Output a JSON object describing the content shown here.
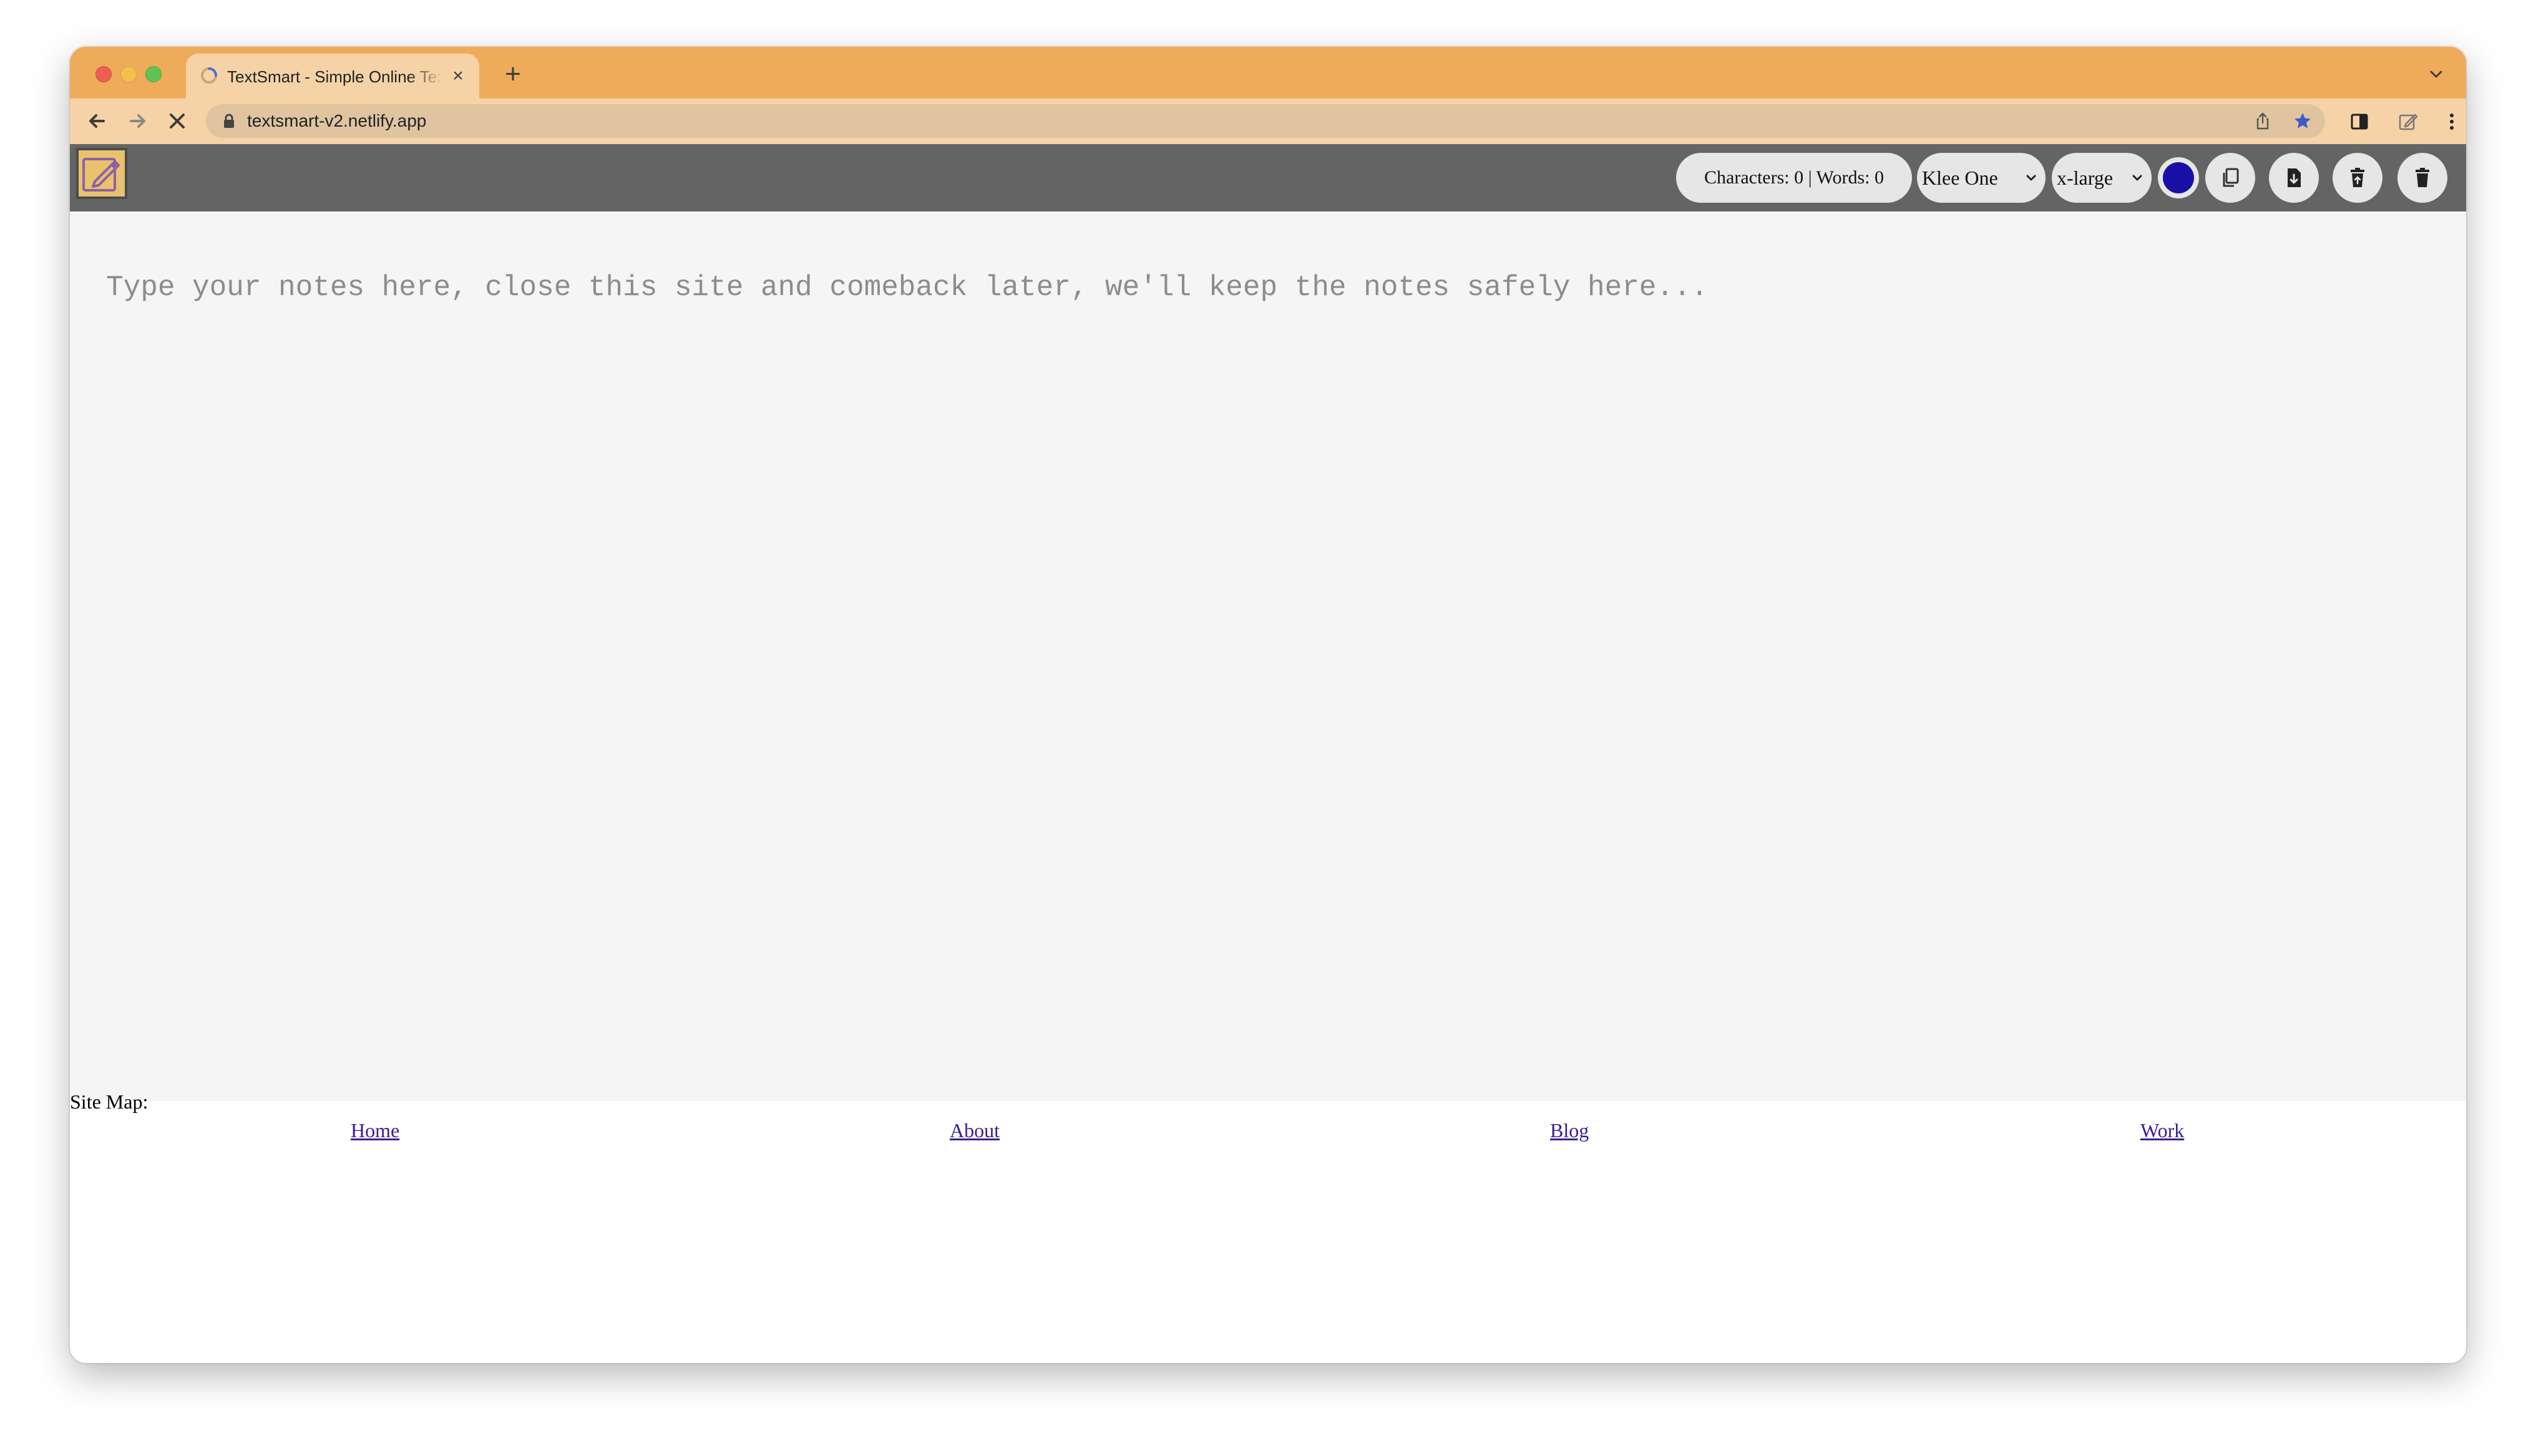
{
  "browser": {
    "tab_title": "TextSmart - Simple Online Text Editor",
    "tab_close": "×",
    "new_tab": "+",
    "url": "textsmart-v2.netlify.app"
  },
  "app": {
    "stats": "Characters: 0 | Words: 0",
    "font_family": "Klee One",
    "font_size": "x-large",
    "text_color": "#1a10a8",
    "placeholder": "Type your notes here, close this site and comeback later, we'll keep the notes safely here...",
    "value": ""
  },
  "footer": {
    "label": "Site Map:",
    "links": [
      "Home",
      "About",
      "Blog",
      "Work"
    ]
  },
  "colors": {
    "tab_strip": "#eeac5a",
    "toolbar": "#f6d3a6",
    "app_header": "#646464",
    "editor_bg": "#f5f5f5"
  }
}
